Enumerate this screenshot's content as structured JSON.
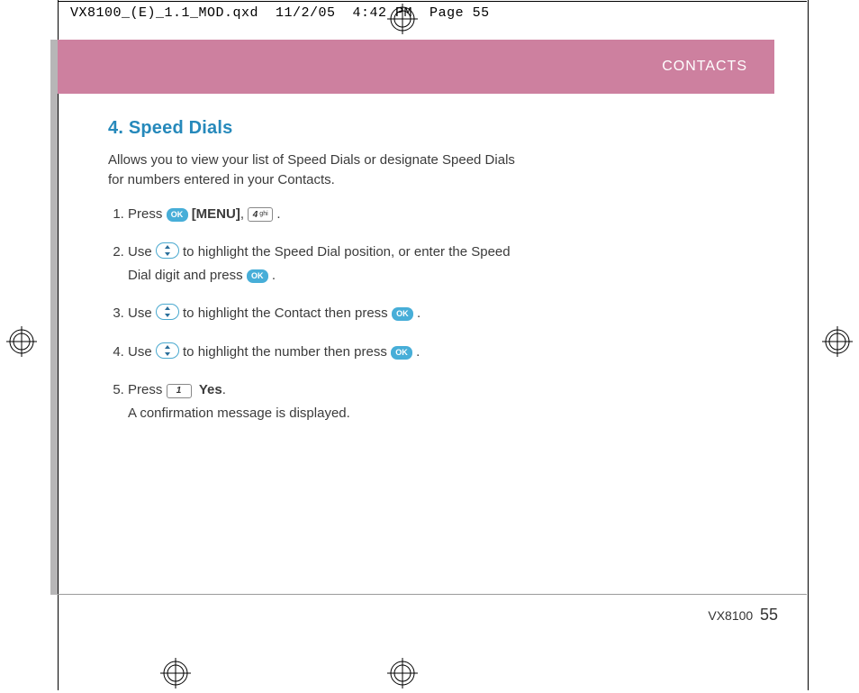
{
  "print_header": "VX8100_(E)_1.1_MOD.qxd  11/2/05  4:42 PM  Page 55",
  "banner": "CONTACTS",
  "section_title": "4. Speed Dials",
  "intro": "Allows you to view your list of Speed Dials or designate Speed Dials for numbers entered in your Contacts.",
  "steps": {
    "s1a": "Press ",
    "s1_menu": "[MENU]",
    "s1b": ", ",
    "s1c": ".",
    "s2a": "Use  ",
    "s2b": " to highlight the Speed Dial position, or enter the Speed Dial digit and press ",
    "s2c": ".",
    "s3a": "Use  ",
    "s3b": "  to highlight the Contact then press ",
    "s3c": ".",
    "s4a": "Use  ",
    "s4b": " to highlight the number then press ",
    "s4c": ".",
    "s5a": "Press ",
    "s5_yes": "Yes",
    "s5b": ".",
    "s5c": "A confirmation message is displayed."
  },
  "keys": {
    "ok": "OK",
    "four": "4",
    "four_sub": "ghi",
    "one": "1"
  },
  "footer_model": "VX8100",
  "footer_page": "55"
}
